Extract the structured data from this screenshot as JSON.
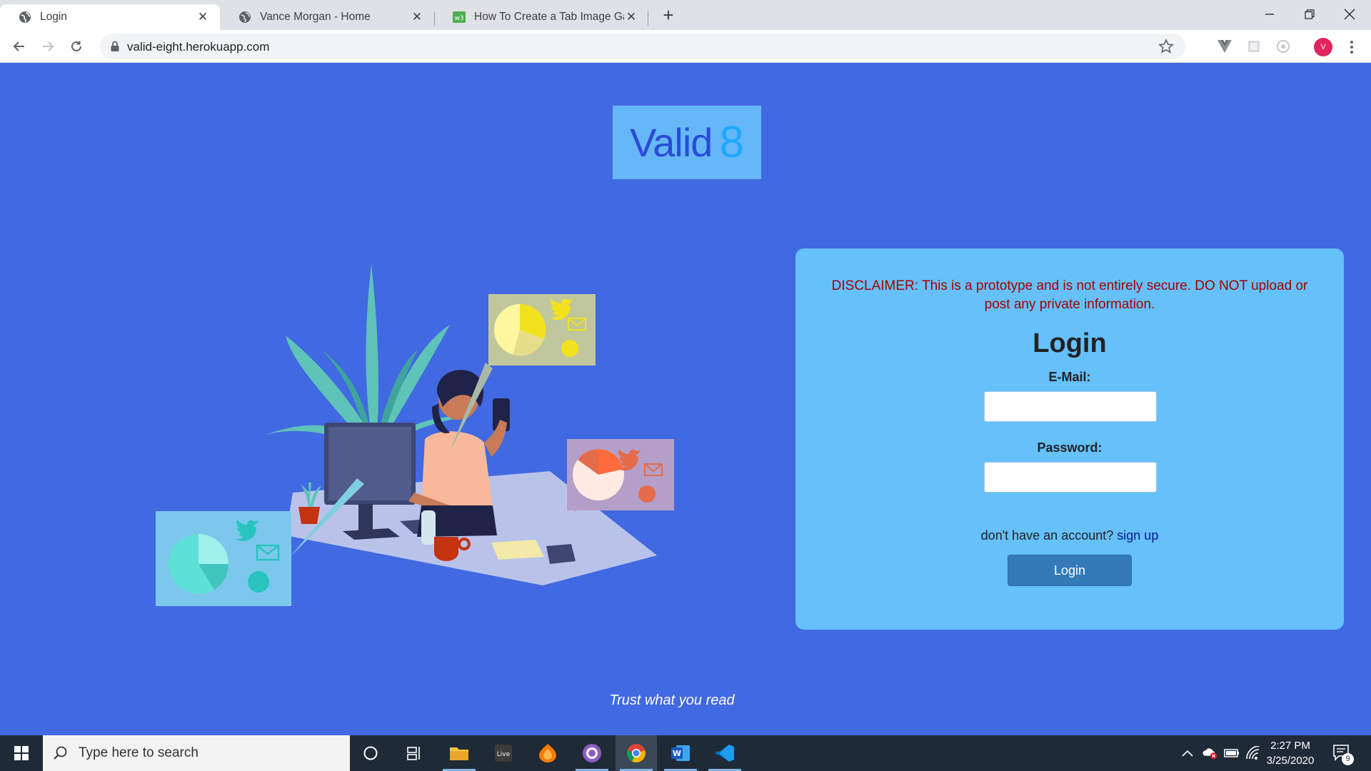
{
  "browser": {
    "tabs": [
      {
        "title": "Login",
        "active": true
      },
      {
        "title": "Vance Morgan - Home",
        "active": false
      },
      {
        "title": "How To Create a Tab Image Galle",
        "active": false
      }
    ],
    "new_tab": "+",
    "url": "valid-eight.herokuapp.com",
    "profile_initial": "V"
  },
  "page": {
    "logo_word": "Valid",
    "logo_number": "8",
    "disclaimer": "DISCLAIMER: This is a prototype and is not entirely secure. DO NOT upload or post any private information.",
    "login_title": "Login",
    "email_label": "E-Mail:",
    "email_value": "",
    "password_label": "Password:",
    "password_value": "",
    "signup_prompt": "don't have an account?",
    "signup_link": "sign up",
    "login_button": "Login",
    "tagline": "Trust what you read"
  },
  "colors": {
    "page_bg": "#4169e1",
    "card_bg": "#66c0fa",
    "logo_bg": "#66b7f8",
    "disclaimer": "#a50000",
    "button": "#337ab7"
  },
  "taskbar": {
    "search_placeholder": "Type here to search",
    "apps": [
      "cortana-icon",
      "task-view-icon",
      "file-explorer-icon",
      "live-icon",
      "fl-studio-icon",
      "github-desktop-icon",
      "chrome-icon",
      "word-icon",
      "vscode-icon"
    ],
    "time": "2:27 PM",
    "date": "3/25/2020",
    "notification_count": "9"
  }
}
